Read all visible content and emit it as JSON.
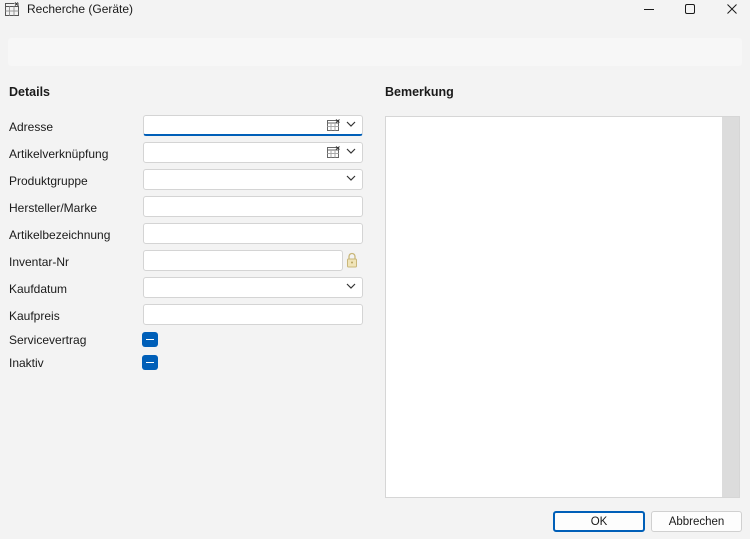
{
  "window": {
    "title": "Recherche (Geräte)"
  },
  "details": {
    "heading": "Details",
    "fields": [
      {
        "label": "Adresse",
        "value": ""
      },
      {
        "label": "Artikelverknüpfung",
        "value": ""
      },
      {
        "label": "Produktgruppe",
        "value": ""
      },
      {
        "label": "Hersteller/Marke",
        "value": ""
      },
      {
        "label": "Artikelbezeichnung",
        "value": ""
      },
      {
        "label": "Inventar-Nr",
        "value": ""
      },
      {
        "label": "Kaufdatum",
        "value": ""
      },
      {
        "label": "Kaufpreis",
        "value": ""
      }
    ],
    "checkboxes": [
      {
        "label": "Servicevertrag",
        "state": "indeterminate"
      },
      {
        "label": "Inaktiv",
        "state": "indeterminate"
      }
    ]
  },
  "remarks": {
    "heading": "Bemerkung",
    "value": ""
  },
  "buttons": {
    "ok": "OK",
    "cancel": "Abbrechen"
  },
  "colors": {
    "accent": "#005fb8",
    "background": "#f3f3f3"
  }
}
